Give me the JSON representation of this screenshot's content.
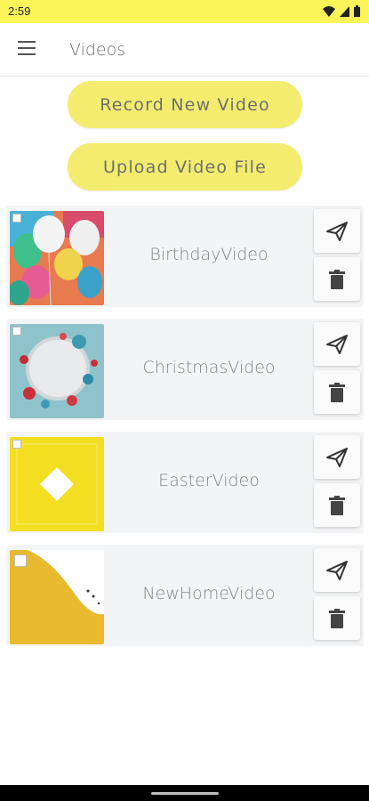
{
  "status_bar": {
    "time": "2:59",
    "icons": [
      "wifi-icon",
      "signal-icon",
      "battery-icon"
    ]
  },
  "app_bar": {
    "menu_icon": "menu-icon",
    "title": "Videos"
  },
  "actions": {
    "record_label": "Record New Video",
    "upload_label": "Upload Video File"
  },
  "videos": [
    {
      "name": "BirthdayVideo",
      "thumbnail": "balloons"
    },
    {
      "name": "ChristmasVideo",
      "thumbnail": "ornament-wreath"
    },
    {
      "name": "EasterVideo",
      "thumbnail": "yellow-diamond"
    },
    {
      "name": "NewHomeVideo",
      "thumbnail": "yellow-curve"
    }
  ],
  "colors": {
    "accent": "#f3ec6e",
    "status_bar": "#fbf55a",
    "card_bg": "#f3f4f5"
  }
}
